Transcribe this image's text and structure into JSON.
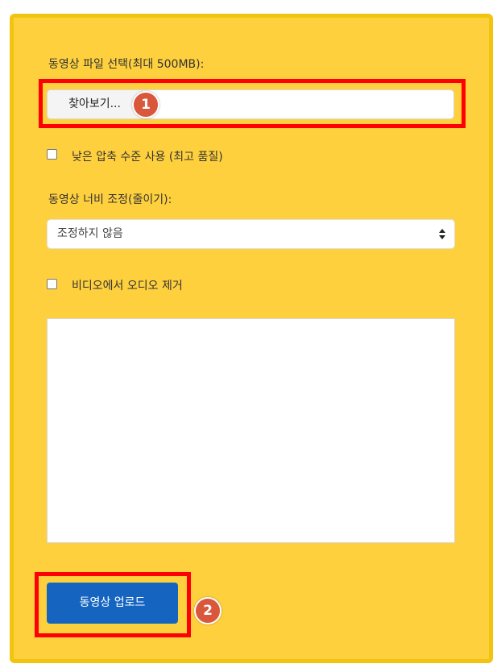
{
  "form": {
    "file_label": "동영상 파일 선택(최대 500MB):",
    "browse_button": "찾아보기...",
    "low_compression_label": "낮은 압축 수준 사용 (최고 품질)",
    "width_label": "동영상 너비 조정(줄이기):",
    "width_select": {
      "selected": "조정하지 않음"
    },
    "remove_audio_label": "비디오에서 오디오 제거",
    "textarea_value": "",
    "upload_button": "동영상 업로드"
  },
  "annotations": {
    "badge_1": "1",
    "badge_2": "2"
  },
  "colors": {
    "panel_background": "#FFD03E",
    "panel_border": "#F1C40F",
    "highlight_red": "#FF0000",
    "badge_orange": "#D9573A",
    "upload_button_blue": "#1565C0"
  },
  "icons": {
    "select_arrows": "up-down-caret-icon"
  }
}
